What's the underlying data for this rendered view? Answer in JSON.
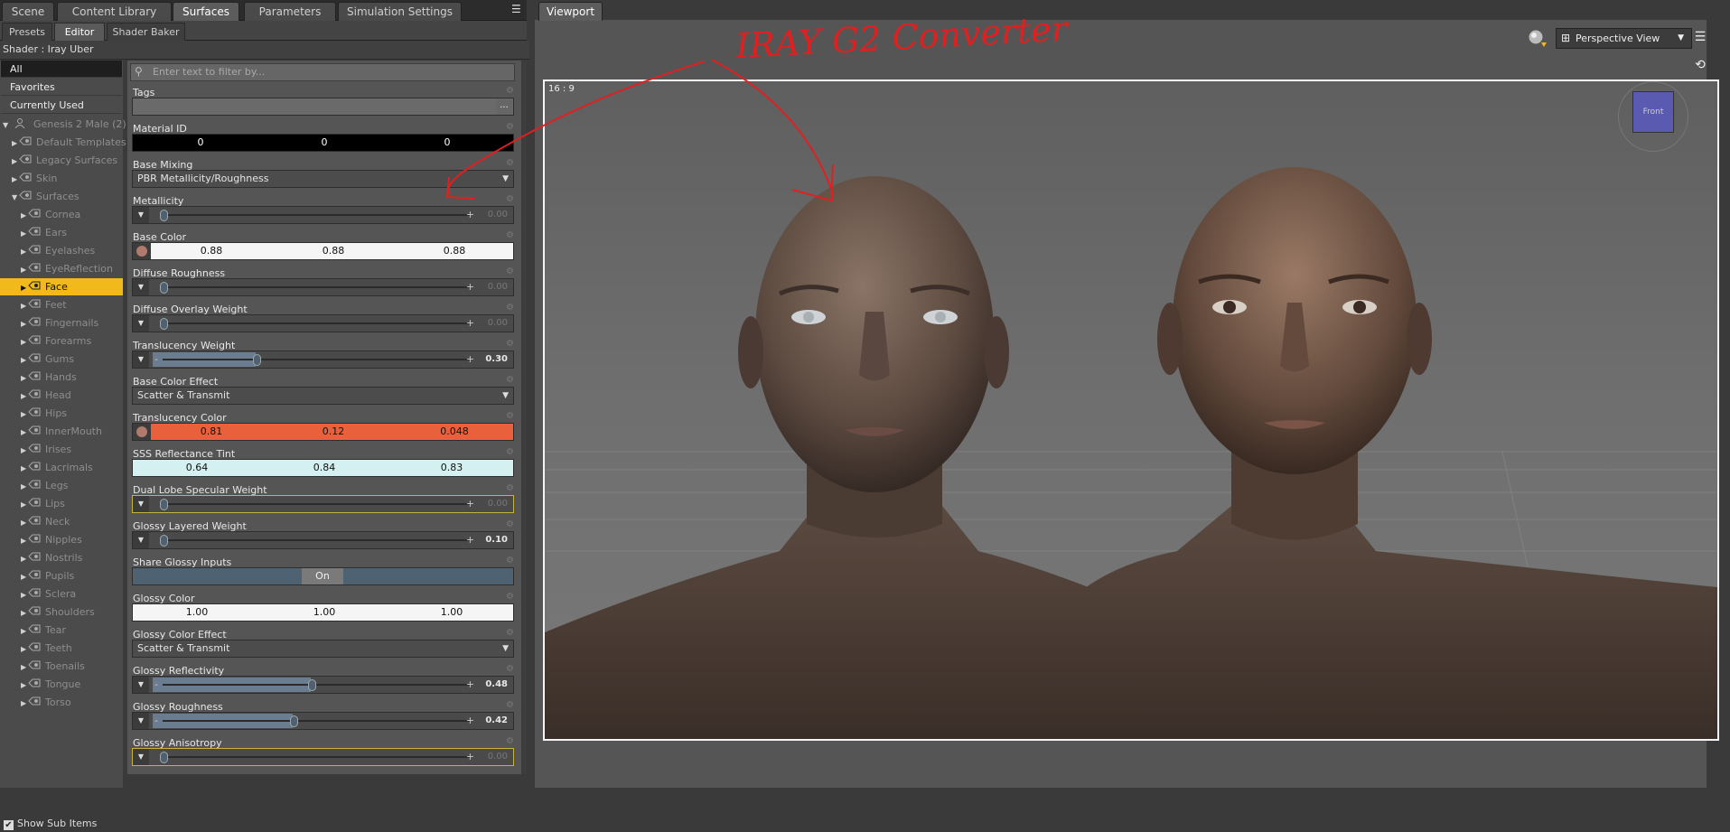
{
  "tabs": [
    "Scene",
    "Content Library",
    "Surfaces",
    "Parameters",
    "Simulation Settings"
  ],
  "subtabs": [
    "Presets",
    "Editor",
    "Shader Baker"
  ],
  "shader_label": "Shader : Iray Uber",
  "filters": [
    "All",
    "Favorites",
    "Currently Used"
  ],
  "tree": {
    "root": "Genesis 2 Male (2)",
    "groups": [
      "Default Templates",
      "Legacy Surfaces",
      "Skin",
      "Surfaces"
    ],
    "surfaces": [
      "Cornea",
      "Ears",
      "Eyelashes",
      "EyeReflection",
      "Face",
      "Feet",
      "Fingernails",
      "Forearms",
      "Gums",
      "Hands",
      "Head",
      "Hips",
      "InnerMouth",
      "Irises",
      "Lacrimals",
      "Legs",
      "Lips",
      "Neck",
      "Nipples",
      "Nostrils",
      "Pupils",
      "Sclera",
      "Shoulders",
      "Tear",
      "Teeth",
      "Toenails",
      "Tongue",
      "Torso"
    ],
    "selected": "Face"
  },
  "show_sub_items": "Show Sub Items",
  "filter_placeholder": "Enter text to filter by...",
  "props": {
    "tags": "Tags",
    "tags_btn": "...",
    "material_id": {
      "label": "Material ID",
      "v1": "0",
      "v2": "0",
      "v3": "0"
    },
    "base_mixing": {
      "label": "Base Mixing",
      "value": "PBR Metallicity/Roughness"
    },
    "metallicity": {
      "label": "Metallicity",
      "value": "0.00",
      "fraction": 0.0
    },
    "base_color": {
      "label": "Base Color",
      "v1": "0.88",
      "v2": "0.88",
      "v3": "0.88"
    },
    "diffuse_roughness": {
      "label": "Diffuse Roughness",
      "value": "0.00",
      "fraction": 0.0
    },
    "diffuse_overlay_weight": {
      "label": "Diffuse Overlay Weight",
      "value": "0.00",
      "fraction": 0.0
    },
    "translucency_weight": {
      "label": "Translucency Weight",
      "value": "0.30",
      "fraction": 0.3
    },
    "base_color_effect": {
      "label": "Base Color Effect",
      "value": "Scatter & Transmit"
    },
    "translucency_color": {
      "label": "Translucency Color",
      "v1": "0.81",
      "v2": "0.12",
      "v3": "0.048",
      "color": "#e8603c"
    },
    "sss_tint": {
      "label": "SSS Reflectance Tint",
      "v1": "0.64",
      "v2": "0.84",
      "v3": "0.83",
      "color": "#d4f0f0"
    },
    "dual_lobe": {
      "label": "Dual Lobe Specular Weight",
      "value": "0.00",
      "fraction": 0.0
    },
    "glossy_layered": {
      "label": "Glossy Layered Weight",
      "value": "0.10",
      "fraction": 0.0
    },
    "share_glossy": {
      "label": "Share Glossy Inputs",
      "value": "On"
    },
    "glossy_color": {
      "label": "Glossy Color",
      "v1": "1.00",
      "v2": "1.00",
      "v3": "1.00"
    },
    "glossy_color_effect": {
      "label": "Glossy Color Effect",
      "value": "Scatter & Transmit"
    },
    "glossy_reflectivity": {
      "label": "Glossy Reflectivity",
      "value": "0.48",
      "fraction": 0.48
    },
    "glossy_roughness": {
      "label": "Glossy Roughness",
      "value": "0.42",
      "fraction": 0.42
    },
    "glossy_anisotropy": {
      "label": "Glossy Anisotropy",
      "value": "0.00",
      "fraction": 0.0
    }
  },
  "viewport": {
    "tab": "Viewport",
    "view": "Perspective View",
    "aspect": "16 : 9",
    "cube_label": "Front",
    "annotation": "IRAY G2 Converter",
    "annotation_color": "#e02020"
  },
  "colors": {
    "selected": "#f2b91a",
    "panel": "#4b4b4b",
    "accent_yellow": "#c8b33d"
  }
}
